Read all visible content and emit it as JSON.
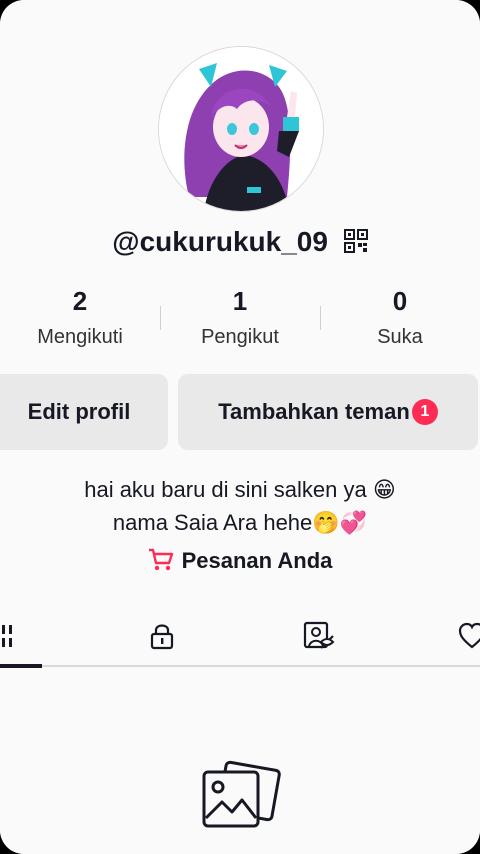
{
  "profile": {
    "username": "@cukurukuk_09",
    "avatar_alt": "avatar",
    "stats": [
      {
        "value": "2",
        "label": "Mengikuti"
      },
      {
        "value": "1",
        "label": "Pengikut"
      },
      {
        "value": "0",
        "label": "Suka"
      }
    ],
    "edit_label": "Edit profil",
    "add_friends_label": "Tambahkan teman",
    "add_friends_badge": "1",
    "bio_line1": "hai aku baru di sini salken ya",
    "bio_line1_emoji": "😁",
    "bio_line2": "nama Saia Ara hehe",
    "bio_line2_emoji": "🤭💞",
    "orders_label": "Pesanan Anda"
  },
  "tabs": [
    {
      "icon": "grid-icon",
      "active": true
    },
    {
      "icon": "lock-icon",
      "active": false
    },
    {
      "icon": "tagged-icon",
      "active": false
    },
    {
      "icon": "liked-icon",
      "active": false
    }
  ],
  "colors": {
    "accent": "#fe2c55",
    "text": "#161823",
    "button_bg": "#e9e9e9",
    "avatar_hair": "#8e3fb0"
  }
}
